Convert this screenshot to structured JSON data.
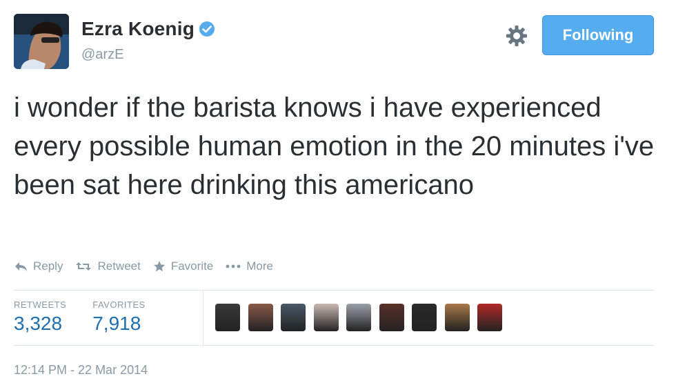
{
  "user": {
    "name": "Ezra Koenig",
    "handle": "@arzE",
    "verified": true
  },
  "follow_button": {
    "label": "Following"
  },
  "tweet": {
    "text": "i wonder if the barista knows i have experienced every possible human emotion in the 20 minutes i've been sat here drinking this americano",
    "timestamp": "12:14 PM - 22 Mar 2014"
  },
  "actions": [
    {
      "label": "Reply",
      "icon": "reply-icon"
    },
    {
      "label": "Retweet",
      "icon": "retweet-icon"
    },
    {
      "label": "Favorite",
      "icon": "star-icon"
    },
    {
      "label": "More",
      "icon": "more-icon"
    }
  ],
  "stats": {
    "retweets_label": "RETWEETS",
    "retweets_value": "3,328",
    "favorites_label": "FAVORITES",
    "favorites_value": "7,918"
  },
  "favorited_by": [
    {
      "color": "#3a3a3a"
    },
    {
      "color": "#8a5a4a"
    },
    {
      "color": "#4a5868"
    },
    {
      "color": "#c9b8b0"
    },
    {
      "color": "#9aa0a8"
    },
    {
      "color": "#5a3028"
    },
    {
      "color": "#2a2a2a"
    },
    {
      "color": "#a87848"
    },
    {
      "color": "#b02828"
    }
  ],
  "colors": {
    "brand_blue": "#55acee",
    "text": "#292f33",
    "muted": "#8899a6",
    "stat_value": "#1f6eb0"
  }
}
